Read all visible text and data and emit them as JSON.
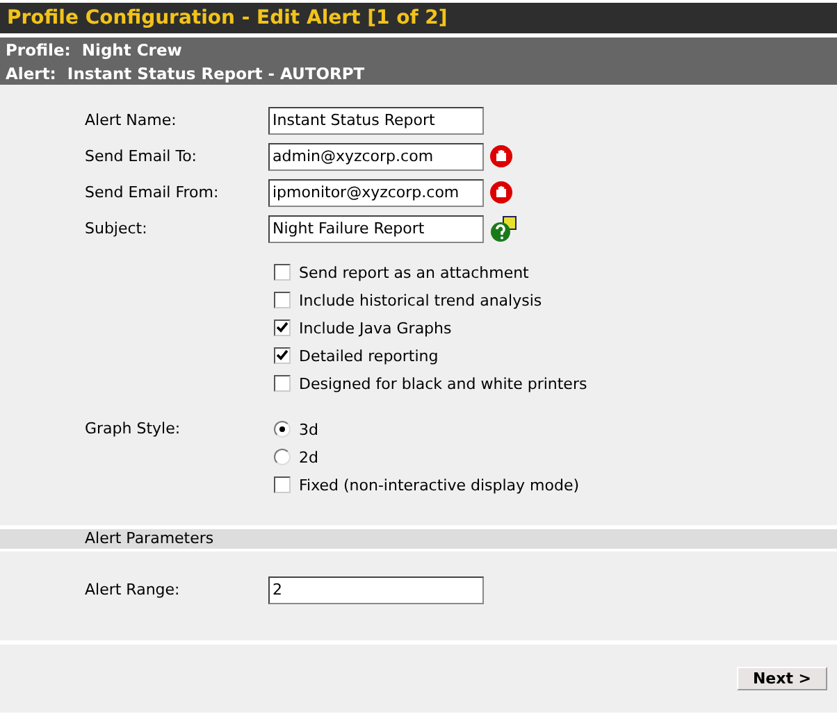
{
  "window": {
    "title": "Profile Configuration - Edit Alert [1 of 2]"
  },
  "header": {
    "profile_label": "Profile:",
    "profile": "Night Crew",
    "alert_label": "Alert:",
    "alert": "Instant Status Report - AUTORPT"
  },
  "fields": [
    {
      "label": "Alert Name:",
      "value": "Instant Status Report",
      "kind": "plain"
    },
    {
      "label": "Send Email To:",
      "value": "admin@xyzcorp.com",
      "kind": "required"
    },
    {
      "label": "Send Email From:",
      "value": "ipmonitor@xyzcorp.com",
      "kind": "required"
    },
    {
      "label": "Subject:",
      "value": "Night Failure Report",
      "kind": "help"
    }
  ],
  "options": [
    {
      "label": "Send report as an attachment",
      "checked": false
    },
    {
      "label": "Include historical trend analysis",
      "checked": false
    },
    {
      "label": "Include Java Graphs",
      "checked": true
    },
    {
      "label": "Detailed reporting",
      "checked": true
    },
    {
      "label": "Designed for black and white printers",
      "checked": false
    }
  ],
  "graph_style": {
    "label": "Graph Style:",
    "choices": [
      {
        "label": "3d",
        "selected": true
      },
      {
        "label": "2d",
        "selected": false
      }
    ],
    "fixed": {
      "label": "Fixed (non-interactive display mode)",
      "checked": false
    }
  },
  "parameters": {
    "title": "Alert Parameters",
    "fields": [
      {
        "label": "Alert Range:",
        "value": "2"
      }
    ]
  },
  "buttons": [
    "Next >"
  ]
}
